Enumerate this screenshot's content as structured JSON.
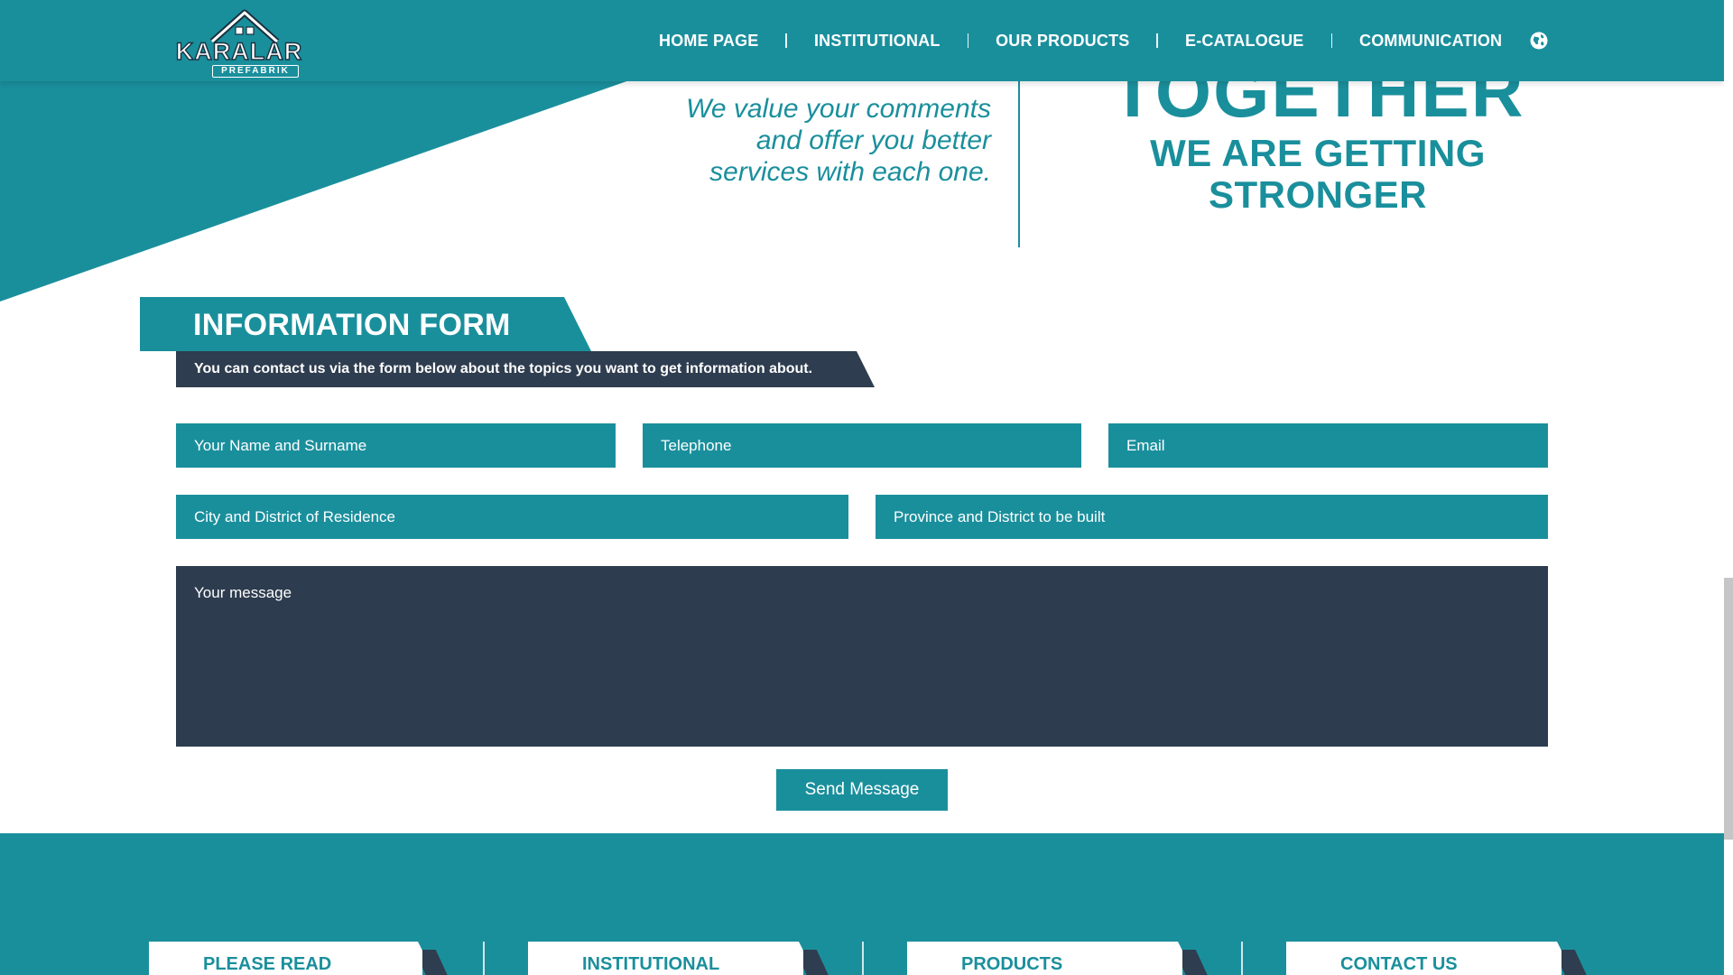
{
  "brand": {
    "logo_text": "KARALAR",
    "logo_sub": "PREFABRIK"
  },
  "nav": {
    "items": [
      {
        "label": "HOME PAGE"
      },
      {
        "label": "INSTITUTIONAL"
      },
      {
        "label": "OUR PRODUCTS"
      },
      {
        "label": "E-CATALOGUE"
      },
      {
        "label": "COMMUNICATION"
      }
    ],
    "language_icon": "globe-icon"
  },
  "hero": {
    "quote_line1": "We value your comments",
    "quote_line2": "and offer you better",
    "quote_line3": "services with each one.",
    "headline": "TOGETHER",
    "subheadline": "WE ARE GETTING STRONGER"
  },
  "form": {
    "title": "INFORMATION FORM",
    "subtitle": "You can contact us via the form below about the topics you want to get information about.",
    "fields": {
      "name_placeholder": "Your Name and Surname",
      "phone_placeholder": "Telephone",
      "email_placeholder": "Email",
      "residence_placeholder": "City and District of Residence",
      "build_location_placeholder": "Province and District to be built",
      "message_placeholder": "Your message"
    },
    "submit_label": "Send Message"
  },
  "footer": {
    "tabs": [
      {
        "label": "PLEASE READ"
      },
      {
        "label": "INSTITUTIONAL"
      },
      {
        "label": "PRODUCTS"
      },
      {
        "label": "CONTACT US"
      }
    ]
  },
  "colors": {
    "primary": "#1a8f9c",
    "dark": "#2e3d4f",
    "white": "#ffffff"
  }
}
